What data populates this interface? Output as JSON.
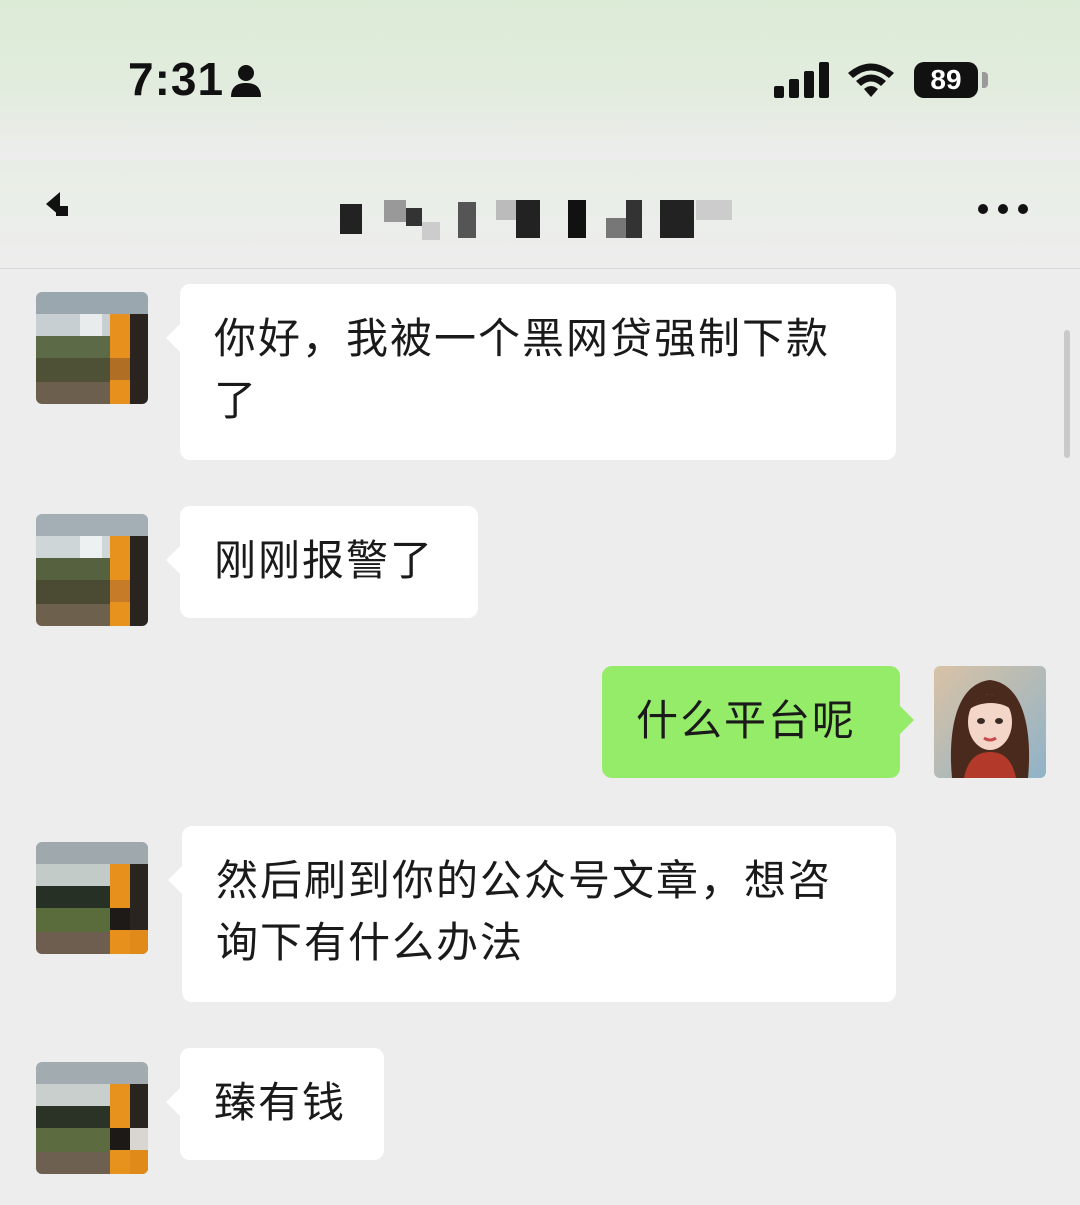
{
  "status_bar": {
    "time": "7:31",
    "battery": "89",
    "icons": [
      "person-icon",
      "signal-icon",
      "wifi-icon",
      "battery-icon"
    ]
  },
  "nav": {
    "icons": [
      "back-icon",
      "more-icon"
    ]
  },
  "messages": [
    {
      "side": "left",
      "text": "你好，我被一个黑网贷强制下款了"
    },
    {
      "side": "left",
      "text": "刚刚报警了"
    },
    {
      "side": "right",
      "text": "什么平台呢"
    },
    {
      "side": "left",
      "text": "然后刷到你的公众号文章，想咨询下有什么办法"
    },
    {
      "side": "left",
      "text": "臻有钱"
    }
  ],
  "colors": {
    "background": "#ededed",
    "bubble_left": "#ffffff",
    "bubble_right": "#95ec69"
  }
}
